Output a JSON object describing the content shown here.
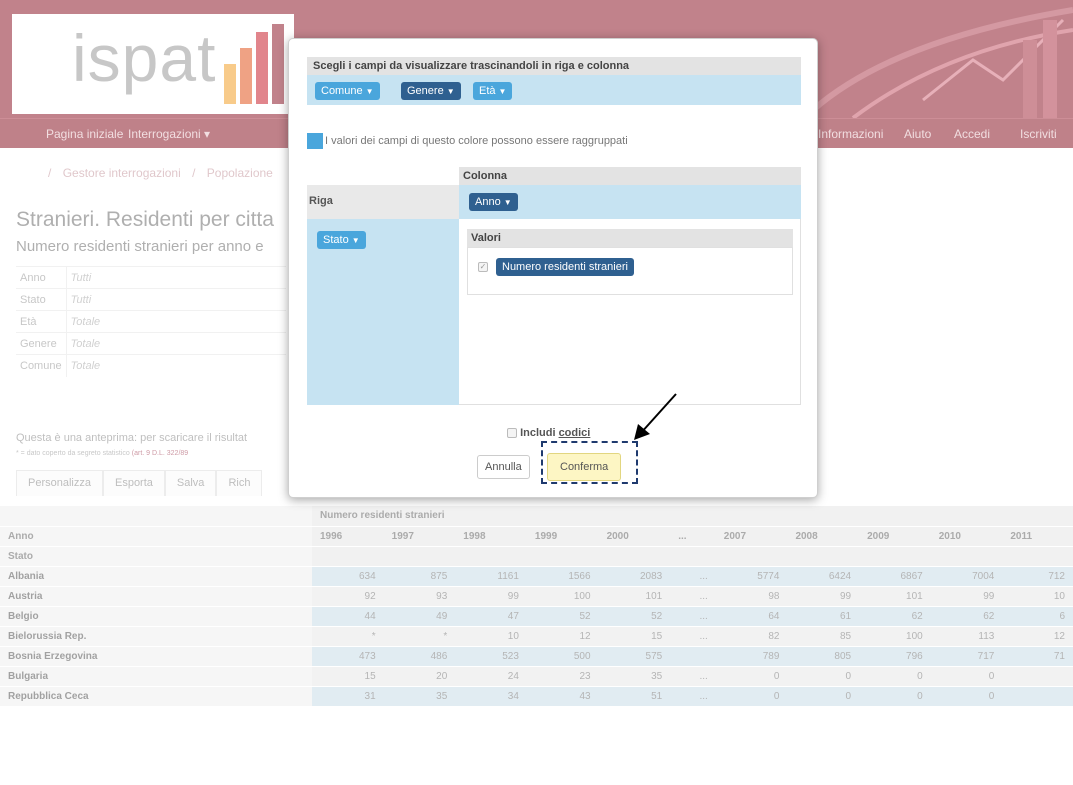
{
  "header": {
    "logo_text": "ispat",
    "nav": [
      "Pagina iniziale",
      "Interrogazioni ▾",
      "Informazioni",
      "Aiuto",
      "Accedi",
      "Iscriviti"
    ]
  },
  "breadcrumb": [
    "/",
    "Gestore interrogazioni",
    "/",
    "Popolazione"
  ],
  "page": {
    "title": "Stranieri. Residenti per citta",
    "subtitle": "Numero residenti stranieri per anno e"
  },
  "filters": [
    {
      "key": "Anno",
      "value": "Tutti"
    },
    {
      "key": "Stato",
      "value": "Tutti"
    },
    {
      "key": "Età",
      "value": "Totale"
    },
    {
      "key": "Genere",
      "value": "Totale"
    },
    {
      "key": "Comune",
      "value": "Totale"
    }
  ],
  "notes": {
    "preview": "Questa è una anteprima: per scaricare il risultat",
    "secret_prefix": "* = dato coperto da segreto statistico ",
    "secret_link": "(art. 9 D.L. 322/89"
  },
  "toolbar": [
    "Personalizza",
    "Esporta",
    "Salva",
    "Rich"
  ],
  "table": {
    "measure": "Numero residenti stranieri",
    "anno_label": "Anno",
    "stato_label": "Stato",
    "years": [
      "1996",
      "1997",
      "1998",
      "1999",
      "2000",
      "...",
      "2007",
      "2008",
      "2009",
      "2010",
      "2011"
    ],
    "rows": [
      {
        "name": "Albania",
        "values": [
          "634",
          "875",
          "1161",
          "1566",
          "2083",
          "...",
          "5774",
          "6424",
          "6867",
          "7004",
          "712"
        ]
      },
      {
        "name": "Austria",
        "values": [
          "92",
          "93",
          "99",
          "100",
          "101",
          "...",
          "98",
          "99",
          "101",
          "99",
          "10"
        ]
      },
      {
        "name": "Belgio",
        "values": [
          "44",
          "49",
          "47",
          "52",
          "52",
          "...",
          "64",
          "61",
          "62",
          "62",
          "6"
        ]
      },
      {
        "name": "Bielorussia Rep.",
        "values": [
          "*",
          "*",
          "10",
          "12",
          "15",
          "...",
          "82",
          "85",
          "100",
          "113",
          "12"
        ]
      },
      {
        "name": "Bosnia Erzegovina",
        "values": [
          "473",
          "486",
          "523",
          "500",
          "575",
          "",
          "789",
          "805",
          "796",
          "717",
          "71"
        ]
      },
      {
        "name": "Bulgaria",
        "values": [
          "15",
          "20",
          "24",
          "23",
          "35",
          "...",
          "0",
          "0",
          "0",
          "0",
          ""
        ]
      },
      {
        "name": "Repubblica Ceca",
        "values": [
          "31",
          "35",
          "34",
          "43",
          "51",
          "...",
          "0",
          "0",
          "0",
          "0",
          ""
        ]
      }
    ]
  },
  "modal": {
    "fields_title": "Scegli i campi da visualizzare trascinandoli in riga e colonna",
    "fields": [
      "Comune",
      "Genere",
      "Età"
    ],
    "legend": "I valori dei campi di questo colore possono essere raggruppati",
    "column_label": "Colonna",
    "column_field": "Anno",
    "row_label": "Riga",
    "row_field": "Stato",
    "values_label": "Valori",
    "value_field": "Numero residenti stranieri",
    "include_codes_prefix": "Includi ",
    "include_codes_link": "codici",
    "cancel": "Annulla",
    "confirm": "Conferma"
  },
  "colors": {
    "header_bg": "#8f1c2c",
    "groupable_field": "#4aa6dc",
    "fixed_field": "#2f6090",
    "drop_zone": "#c6e3f2",
    "confirm_bg": "#fdf6c4"
  }
}
